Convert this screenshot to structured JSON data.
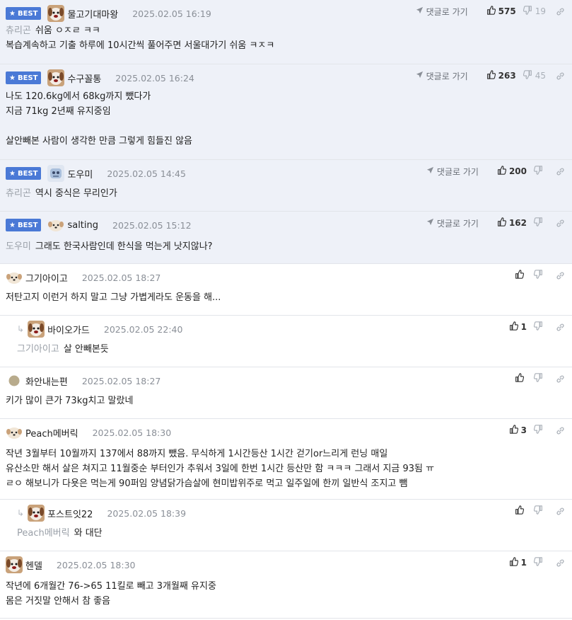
{
  "labels": {
    "best": "BEST",
    "reply_to": "댓글로 가기"
  },
  "colors": {
    "best_bg": "#eef1f8",
    "badge": "#4a79d6",
    "mention": "#9aa0a8"
  },
  "comments": [
    {
      "best": true,
      "nick": "물고기대마왕",
      "time": "2025.02.05 16:19",
      "avatar": "dog-face",
      "up": "575",
      "down": "19",
      "mention": "츄리곤",
      "lines": [
        "쉬움 ㅇㅈㄹ ㅋㅋ",
        "복습계속하고 기출 하루에 10시간씩 풀어주면 서울대가기 쉬움 ㅋㅈㅋ"
      ]
    },
    {
      "best": true,
      "nick": "수구꼴통",
      "time": "2025.02.05 16:24",
      "avatar": "dog-face",
      "up": "263",
      "down": "45",
      "mention": "",
      "lines": [
        "나도 120.6kg에서 68kg까지 뺐다가",
        "지금 71kg 2년째 유지중임",
        "",
        "살안빼본 사람이 생각한 만큼 그렇게 힘들진 않음"
      ]
    },
    {
      "best": true,
      "nick": "도우미",
      "time": "2025.02.05 14:45",
      "avatar": "robot-face",
      "up": "200",
      "down": "",
      "mention": "츄리곤",
      "lines": [
        "역시 중식은 무리인가"
      ]
    },
    {
      "best": true,
      "nick": "salting",
      "time": "2025.02.05 15:12",
      "avatar": "puppy",
      "up": "162",
      "down": "",
      "mention": "도우미",
      "lines": [
        "그래도 한국사람인데 한식을 먹는게 낫지않나?"
      ]
    },
    {
      "best": false,
      "nick": "그기아이고",
      "time": "2025.02.05 18:27",
      "avatar": "puppy",
      "up": "",
      "down": "",
      "mention": "",
      "lines": [
        "저탄고지 이런거 하지 말고 그냥 가볍게라도 운동을 해..."
      ]
    },
    {
      "best": false,
      "reply": true,
      "nick": "바이오가드",
      "time": "2025.02.05 22:40",
      "avatar": "dog-face",
      "up": "1",
      "down": "",
      "mention": "그기아이고",
      "lines": [
        "살 안빼본듯"
      ]
    },
    {
      "best": false,
      "nick": "화안내는편",
      "time": "2025.02.05 18:27",
      "avatar": "dot",
      "up": "",
      "down": "",
      "mention": "",
      "lines": [
        "키가 많이 큰가 73kg치고 말랐네"
      ]
    },
    {
      "best": false,
      "nick": "Peach메버릭",
      "time": "2025.02.05 18:30",
      "avatar": "puppy",
      "up": "3",
      "down": "",
      "mention": "",
      "lines": [
        "작년 3월부터 10월까지 137에서 88까지 뺐음. 무식하게 1시간등산 1시간 걷기or느리게 런닝 매일",
        "유산소만 해서 살은 쳐지고 11월중순 부터인가 추워서 3일에 한번 1시간 등산만 함 ㅋㅋㅋ 그래서 지금 93됨 ㅠ",
        "ㄹㅇ 해보니가 다욧은 먹는게 90퍼임 양념닭가슴살에 현미밥위주로 먹고 일주일에 한끼 일반식 조지고 뺌"
      ]
    },
    {
      "best": false,
      "reply": true,
      "nick": "포스트잇22",
      "time": "2025.02.05 18:39",
      "avatar": "dog-face",
      "up": "",
      "down": "",
      "mention": "Peach메버릭",
      "lines": [
        "와 대단"
      ]
    },
    {
      "best": false,
      "nick": "헨델",
      "time": "2025.02.05 18:30",
      "avatar": "dog-face",
      "up": "1",
      "down": "",
      "mention": "",
      "lines": [
        "작년에 6개월간 76->65 11킬로 빼고 3개월째 유지중",
        "몸은 거짓말 안해서 참 좋음"
      ]
    }
  ]
}
